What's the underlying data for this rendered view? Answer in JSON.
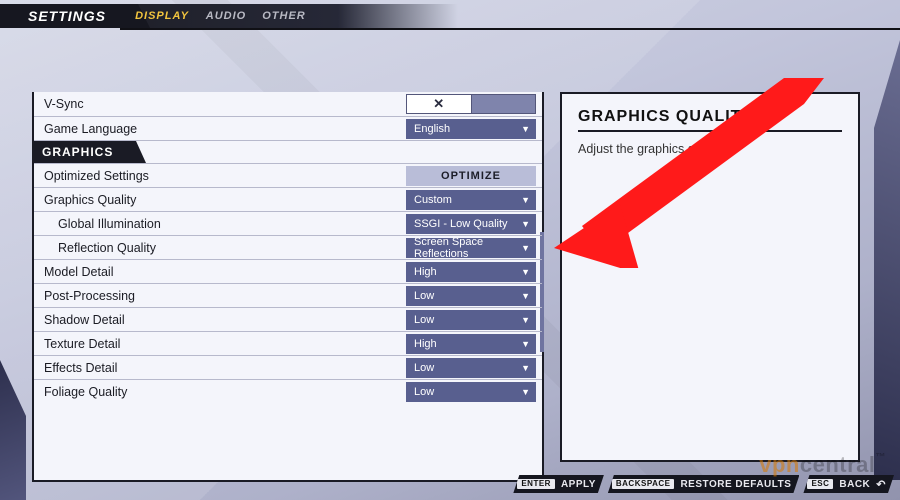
{
  "header": {
    "title": "SETTINGS",
    "tabs": [
      "DISPLAY",
      "AUDIO",
      "OTHER"
    ],
    "active_tab": 0
  },
  "sidebar": {
    "heading": "GRAPHICS QUALITY",
    "description": "Adjust the graphics quality."
  },
  "rows": {
    "vsync_label": "V-Sync",
    "vsync_value": "✕",
    "lang_label": "Game Language",
    "lang_value": "English",
    "section_graphics": "GRAPHICS",
    "optset_label": "Optimized Settings",
    "optset_button": "OPTIMIZE",
    "gfxq_label": "Graphics Quality",
    "gfxq_value": "Custom",
    "gi_label": "Global Illumination",
    "gi_value": "SSGI - Low Quality",
    "refl_label": "Reflection Quality",
    "refl_value": "Screen Space Reflections",
    "model_label": "Model Detail",
    "model_value": "High",
    "post_label": "Post-Processing",
    "post_value": "Low",
    "shadow_label": "Shadow Detail",
    "shadow_value": "Low",
    "tex_label": "Texture Detail",
    "tex_value": "High",
    "fx_label": "Effects Detail",
    "fx_value": "Low",
    "foliage_label": "Foliage Quality",
    "foliage_value": "Low"
  },
  "footer": {
    "apply_key": "ENTER",
    "apply_label": "APPLY",
    "restore_key": "BACKSPACE",
    "restore_label": "RESTORE DEFAULTS",
    "back_key": "ESC",
    "back_label": "BACK"
  },
  "watermark": {
    "a": "vpn",
    "b": "central",
    "tm": "™"
  },
  "colors": {
    "accent": "#f2c53e",
    "dropdown": "#585f8f",
    "ink": "#1a1b25"
  }
}
